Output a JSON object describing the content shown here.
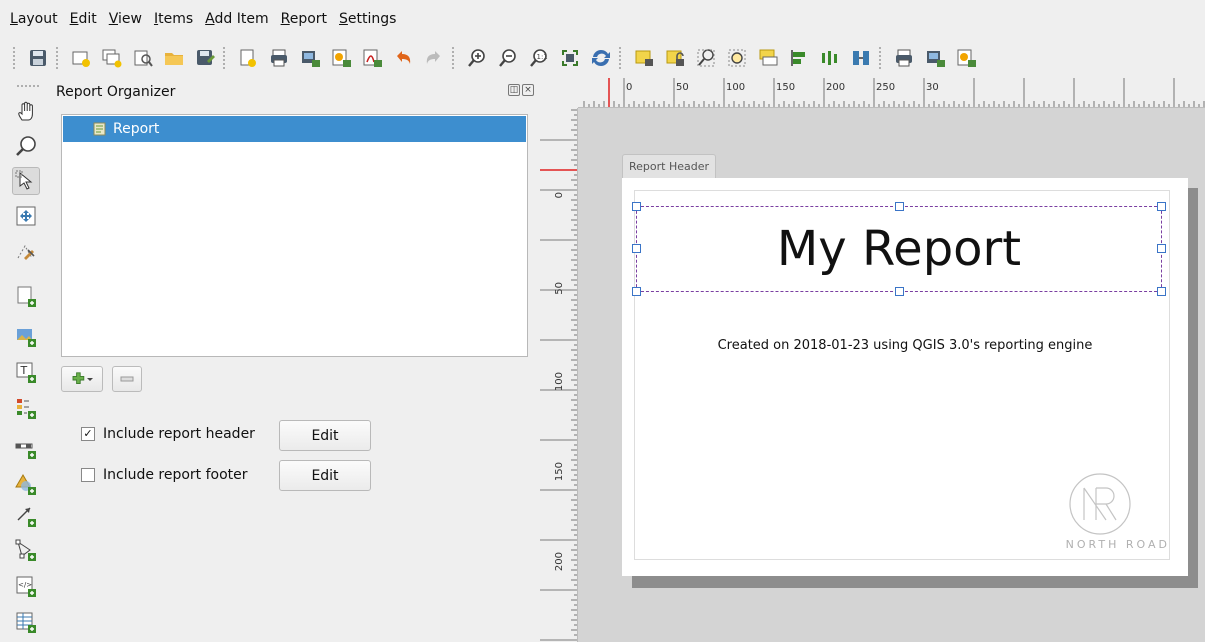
{
  "menu": {
    "items": [
      {
        "first": "L",
        "rest": "ayout"
      },
      {
        "first": "E",
        "rest": "dit"
      },
      {
        "first": "V",
        "rest": "iew"
      },
      {
        "first": "I",
        "rest": "tems"
      },
      {
        "first": "A",
        "rest": "dd Item"
      },
      {
        "first": "R",
        "rest": "eport"
      },
      {
        "first": "S",
        "rest": "ettings"
      }
    ]
  },
  "panel": {
    "title": "Report Organizer",
    "tree_item": "Report",
    "include_header_label": "Include report header",
    "include_header_checked": true,
    "include_footer_label": "Include report footer",
    "include_footer_checked": false,
    "edit_label": "Edit",
    "edit2_label": "Edit",
    "check_mark": "✓"
  },
  "rulers": {
    "h_ticks": [
      "0",
      "50",
      "100",
      "150",
      "200",
      "250",
      "30"
    ],
    "v_ticks": [
      "0",
      "50",
      "100",
      "150",
      "200"
    ]
  },
  "canvas": {
    "section_label": "Report Header",
    "title": "My Report",
    "subtitle": "Created on 2018-01-23 using QGIS 3.0's reporting engine",
    "logo_text": "NORTH ROAD"
  },
  "colors": {
    "selection": "#3d8ecf",
    "frame_dash": "#7a3fa1",
    "handle": "#3a74c7",
    "ruler_marker": "#e02020"
  }
}
